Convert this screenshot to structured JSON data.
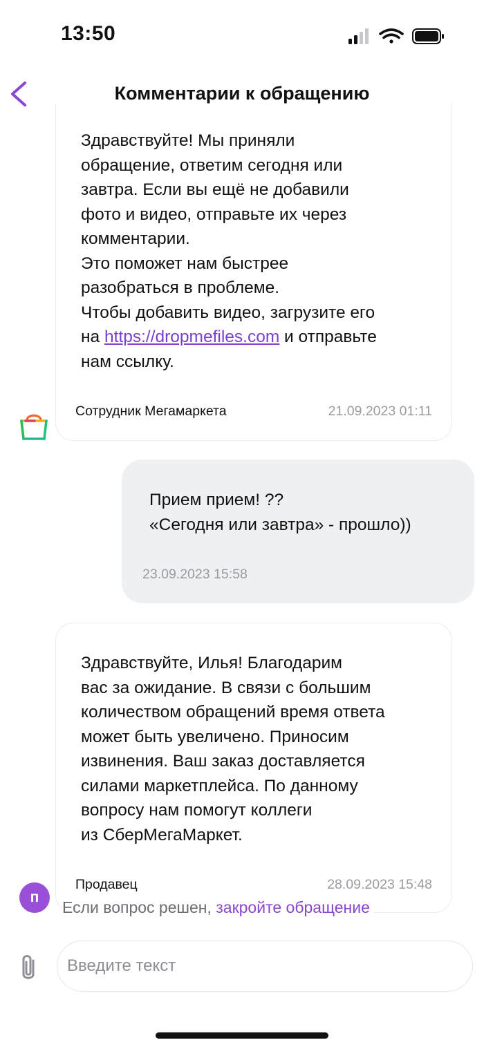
{
  "status_bar": {
    "time": "13:50",
    "icons": [
      "signal-icon",
      "wifi-icon",
      "battery-icon"
    ]
  },
  "header": {
    "title": "Комментарии к обращению",
    "back_icon": "chevron-left-icon"
  },
  "messages": [
    {
      "direction": "incoming",
      "text": "Здравствуйте! Мы приняли\nобращение, ответим сегодня или\nзавтра. Если вы ещё не добавили\nфото и видео, отправьте их через\nкомментарии.\nЭто поможет нам быстрее\nразобраться в проблеме.\nЧтобы добавить видео, загрузите его\nна ",
      "link": "https://dropmefiles.com",
      "text_after": " и отправьте\nнам ссылку.",
      "author": "Сотрудник Мегамаркета",
      "date": "21.09.2023 01:11",
      "avatar_icon": "megamarket-bag-logo-icon"
    },
    {
      "direction": "outgoing",
      "text": "Прием прием! ??\n«Сегодня или завтра» - прошло))",
      "date": "23.09.2023 15:58"
    },
    {
      "direction": "incoming",
      "text": "Здравствуйте, Илья! Благодарим\nвас за ожидание. В связи с большим\nколичеством обращений время ответа\nможет быть увеличено. Приносим\nизвинения. Ваш заказ доставляется\nсилами маркетплейса. По данному\nвопросу нам помогут коллеги\nиз СберМегаМаркет.",
      "author": "Продавец",
      "date": "28.09.2023 15:48",
      "avatar_letter": "п"
    }
  ],
  "resolved": {
    "prefix": "Если вопрос решен, ",
    "link": "закройте обращение"
  },
  "composer": {
    "placeholder": "Введите текст",
    "attach_icon": "paperclip-icon"
  },
  "colors": {
    "accent": "#7a3fcf",
    "avatar_bg": "#9a4fd9",
    "outgoing_bubble": "#eef0f1"
  }
}
